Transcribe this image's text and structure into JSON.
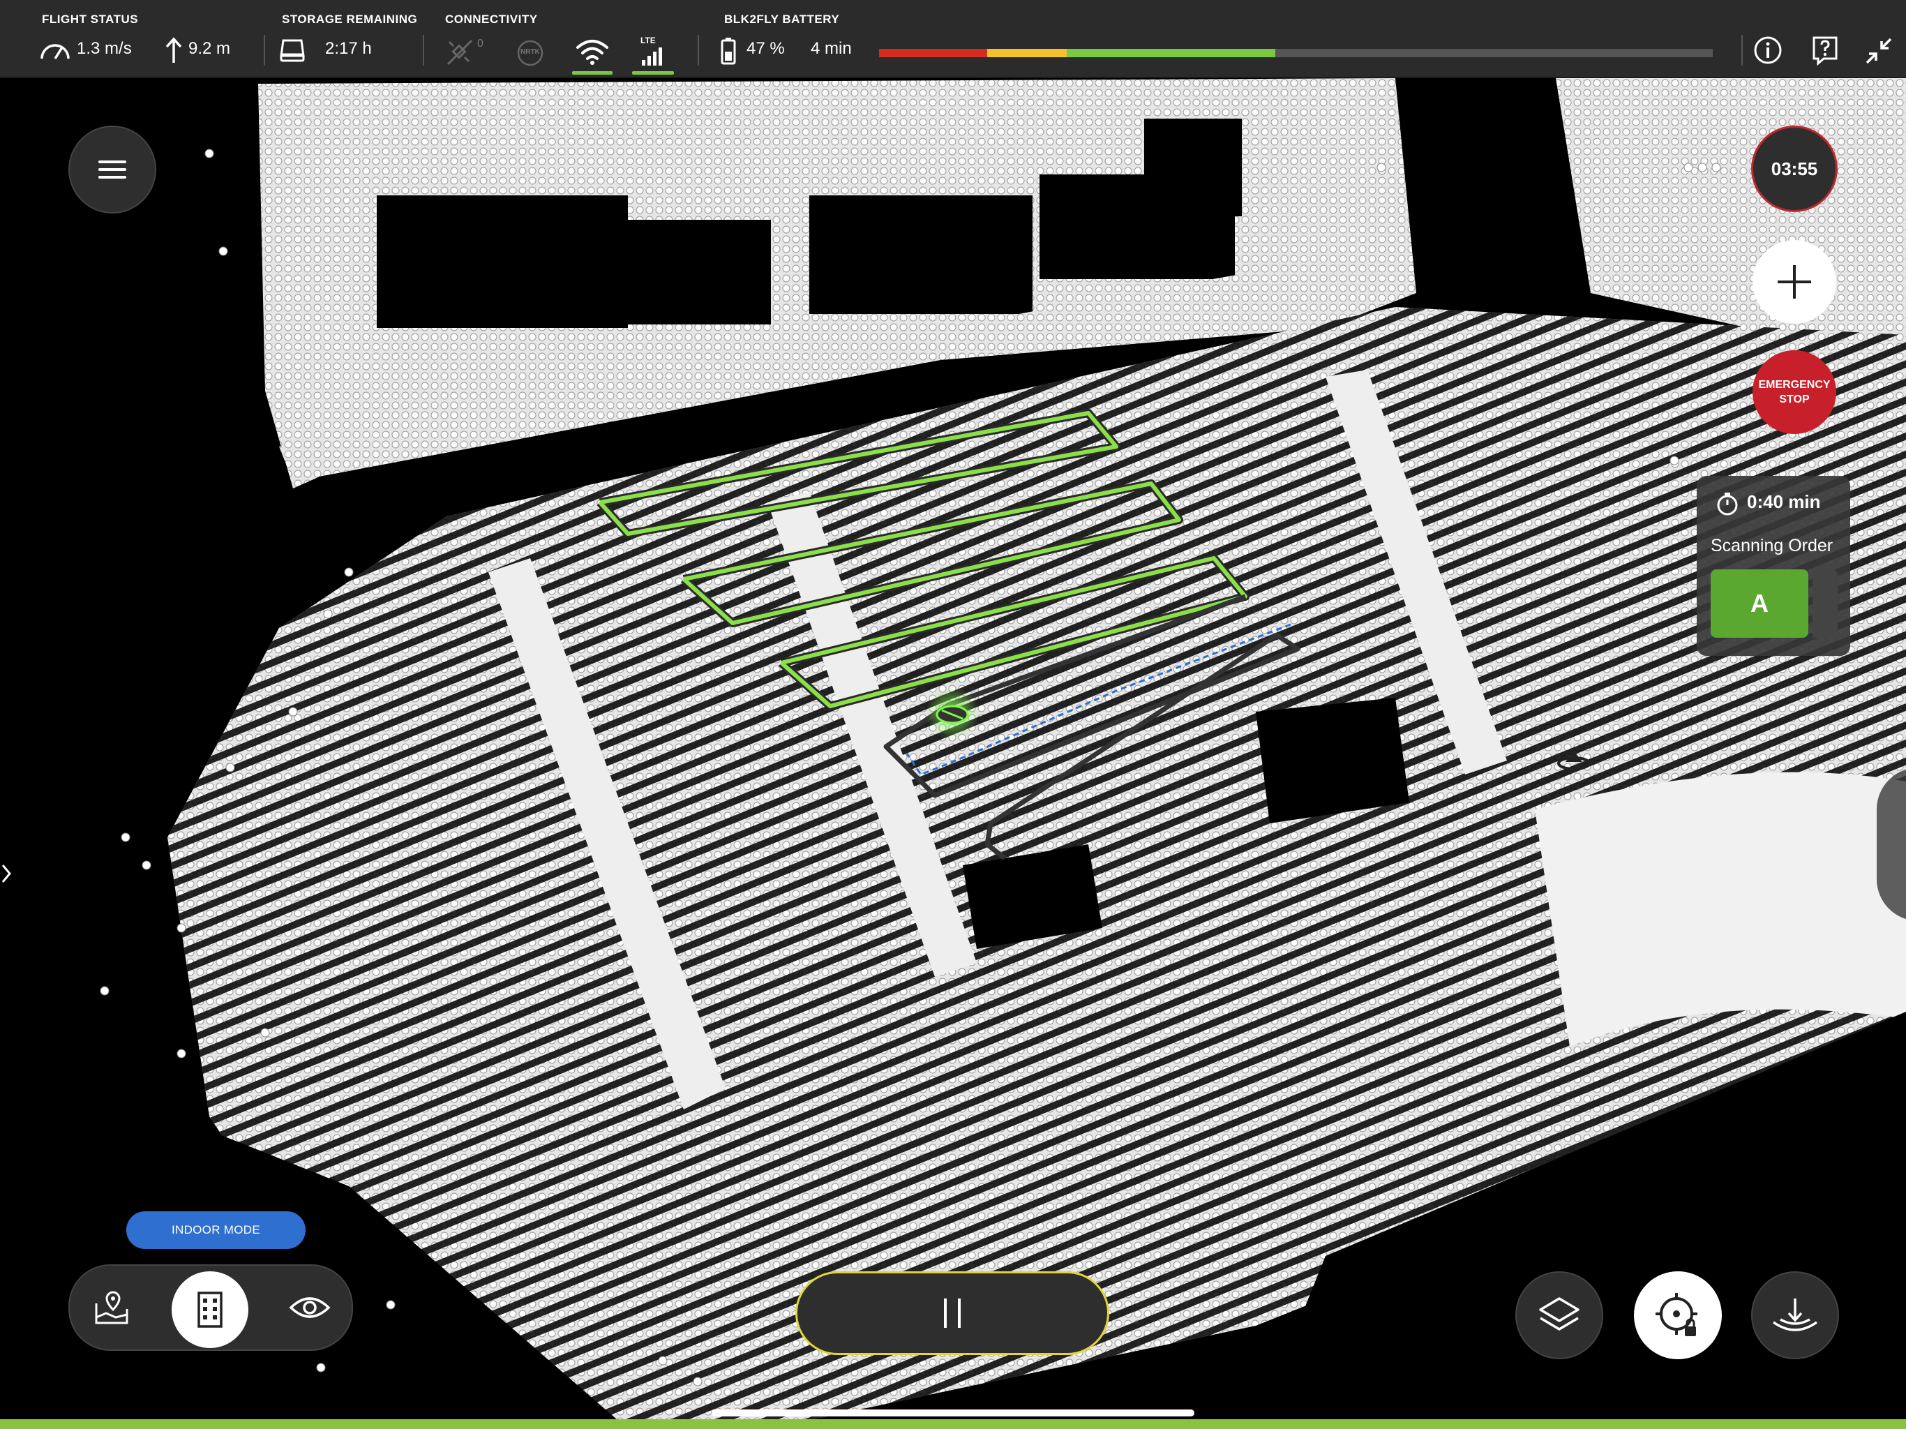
{
  "topbar": {
    "flight_status_label": "FLIGHT STATUS",
    "speed": "1.3 m/s",
    "altitude": "9.2 m",
    "storage_label": "STORAGE REMAINING",
    "storage_time": "2:17 h",
    "connectivity_label": "CONNECTIVITY",
    "gps_count": "0",
    "nrtk_label": "NRTK",
    "lte_label": "LTE",
    "battery_label": "BLK2FLY BATTERY",
    "battery_percent": "47 %",
    "battery_time": "4 min",
    "battery_bar": {
      "red_fraction": 0.13,
      "yellow_fraction": 0.095,
      "green_fraction": 0.25,
      "colors": {
        "red": "#d62b1f",
        "yellow": "#f2c12e",
        "green": "#7ac943",
        "track": "#555555"
      }
    },
    "icons": [
      "speedometer-icon",
      "altitude-arrow-icon",
      "storage-drive-icon",
      "satellite-icon",
      "nrtk-icon",
      "wifi-icon",
      "lte-signal-icon",
      "battery-icon",
      "info-icon",
      "help-icon",
      "collapse-icon"
    ]
  },
  "controls": {
    "timer": "03:55",
    "emergency_line1": "EMERGENCY",
    "emergency_line2": "STOP",
    "scan_time": "0:40 min",
    "scan_label": "Scanning Order",
    "scan_value": "A",
    "indoor_mode": "INDOOR MODE"
  },
  "colors": {
    "accent_green": "#7ac943",
    "emergency_red": "#c8202a",
    "indoor_blue": "#2f6fd0",
    "pause_border": "#e0d53a",
    "scan_green": "#5aa830"
  }
}
